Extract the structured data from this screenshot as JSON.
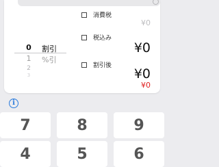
{
  "top_input": {
    "icon": "circle-icon"
  },
  "picker": {
    "items": [
      {
        "num": "0",
        "unit": "割引"
      },
      {
        "num": "1",
        "unit": "%引"
      },
      {
        "num": "2",
        "unit": ""
      },
      {
        "num": "3",
        "unit": ""
      }
    ],
    "selected_index": 0
  },
  "tax": {
    "label": "消費税",
    "amount": "¥0"
  },
  "tax_included": {
    "label": "税込み",
    "amount": "¥0"
  },
  "after_discount": {
    "label": "割引後",
    "amount": "¥0",
    "difference": "¥0"
  },
  "info": {
    "icon": "info-icon",
    "glyph": "i"
  },
  "keypad": {
    "keys": [
      "7",
      "8",
      "9",
      "4",
      "5",
      "6"
    ]
  },
  "colors": {
    "background": "#ececef",
    "card": "#ffffff",
    "accent_blue": "#2a7bdc",
    "negative_red": "#e02020"
  }
}
